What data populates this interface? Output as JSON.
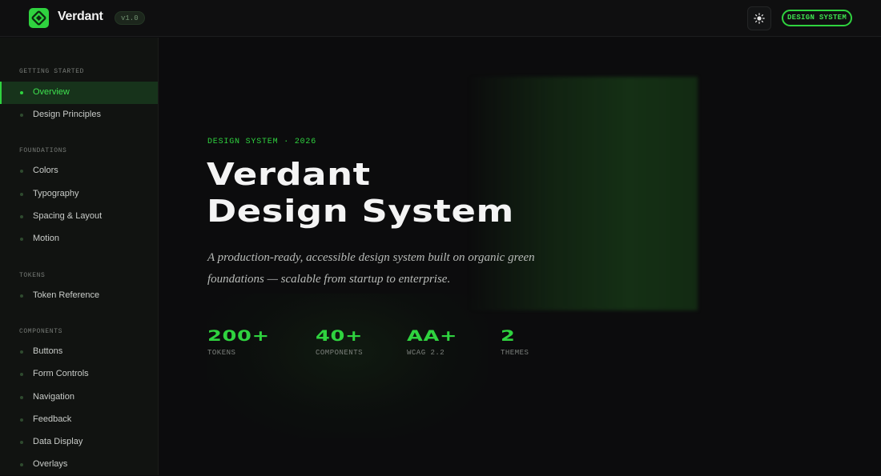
{
  "header": {
    "brand": "Verdant",
    "version": "v1.0",
    "badge": "DESIGN SYSTEM"
  },
  "sidebar": {
    "sections": [
      {
        "title": "GETTING STARTED",
        "items": [
          "Overview",
          "Design Principles"
        ]
      },
      {
        "title": "FOUNDATIONS",
        "items": [
          "Colors",
          "Typography",
          "Spacing & Layout",
          "Motion"
        ]
      },
      {
        "title": "TOKENS",
        "items": [
          "Token Reference"
        ]
      },
      {
        "title": "COMPONENTS",
        "items": [
          "Buttons",
          "Form Controls",
          "Navigation",
          "Feedback",
          "Data Display",
          "Overlays"
        ]
      }
    ],
    "active_item": "Overview"
  },
  "hero": {
    "eyebrow": "DESIGN SYSTEM · 2026",
    "title_line1": "Verdant",
    "title_line2": "Design System",
    "lead": "A production-ready, accessible design system built on organic green foundations — scalable from startup to enterprise."
  },
  "stats": [
    {
      "value": "200+",
      "label": "TOKENS"
    },
    {
      "value": "40+",
      "label": "COMPONENTS"
    },
    {
      "value": "AA+",
      "label": "WCAG 2.2"
    },
    {
      "value": "2",
      "label": "THEMES"
    }
  ],
  "colors": {
    "accent": "#2fd33f",
    "background": "#0d0d0e",
    "sidebar": "#111311",
    "active_row": "#17331b"
  },
  "icons": {
    "logo": "diamond-logo-icon",
    "theme_toggle": "sun-icon",
    "nav_bullet": "dot-icon"
  }
}
